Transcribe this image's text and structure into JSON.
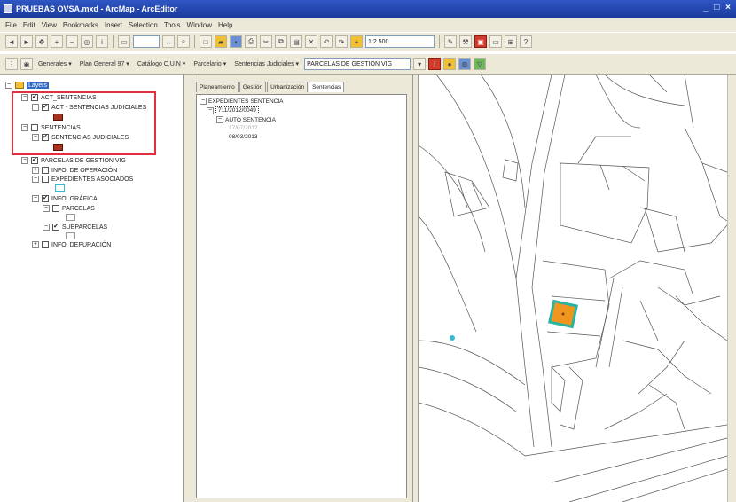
{
  "window": {
    "title": "PRUEBAS OVSA.mxd - ArcMap - ArcEditor",
    "controls": "_ □ ×"
  },
  "menu": [
    "File",
    "Edit",
    "View",
    "Bookmarks",
    "Insert",
    "Selection",
    "Tools",
    "Window",
    "Help"
  ],
  "toolbar1": {
    "scale": "1:2.500"
  },
  "toolbar2": {
    "menus": [
      "Generales ▾",
      "Plan General 97 ▾",
      "Catálogo C.U.N ▾",
      "Parcelario ▾",
      "Sentencias Judiciales ▾"
    ],
    "layer_combo": "PARCELAS DE GESTION VIG"
  },
  "toc": {
    "root": "Layers",
    "items": [
      {
        "label": "ACT_SENTENCIAS",
        "checked": true
      },
      {
        "label": "ACT - SENTENCIAS JUDICIALES",
        "checked": true
      },
      {
        "label": "SENTENCIAS",
        "checked": false
      },
      {
        "label": "SENTENCIAS JUDICIALES",
        "checked": true
      },
      {
        "label": "PARCELAS DE GESTION VIG",
        "checked": true
      },
      {
        "label": "INFO. DE OPERACIÓN",
        "checked": false
      },
      {
        "label": "EXPEDIENTES ASOCIADOS",
        "checked": false
      },
      {
        "label": "INFO. GRÁFICA",
        "checked": true
      },
      {
        "label": "PARCELAS",
        "checked": false
      },
      {
        "label": "SUBPARCELAS",
        "checked": true
      },
      {
        "label": "INFO. DEPURACIÓN",
        "checked": false
      }
    ]
  },
  "panel": {
    "tabs": [
      "Planeamiento",
      "Gestión",
      "Urbanización",
      "Sentencias"
    ],
    "tree": {
      "root": "EXPEDIENTES SENTENCIA",
      "expediente": "711/2012/0049",
      "auto": "AUTO SENTENCIA",
      "date1": "17/07/2012",
      "date2": "08/03/2013"
    }
  },
  "colors": {
    "highlight": "#e03040",
    "parcel_fill": "#f0961e",
    "parcel_outline": "#28b4a0",
    "point": "#3ab8d0"
  }
}
